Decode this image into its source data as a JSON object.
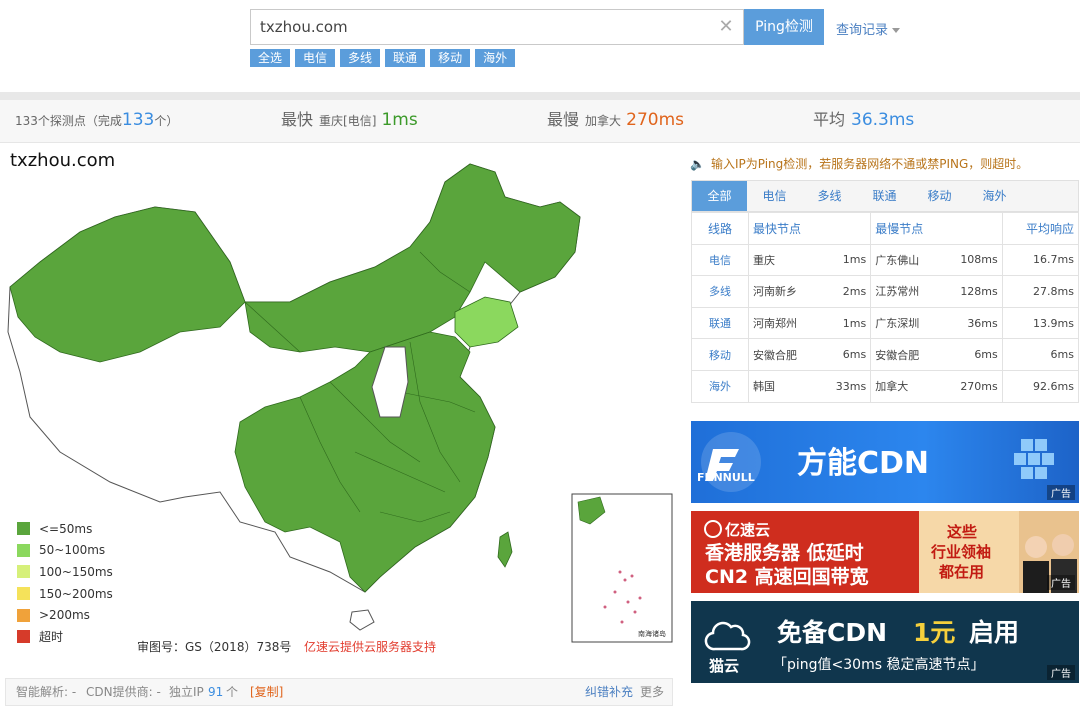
{
  "search": {
    "value": "txzhou.com",
    "button": "Ping检测",
    "history": "查询记录"
  },
  "filters": [
    "全选",
    "电信",
    "多线",
    "联通",
    "移动",
    "海外"
  ],
  "stats": {
    "count_prefix": "133个探测点（完成",
    "count": "133",
    "count_suffix": "个）",
    "fastest_label": "最快",
    "fastest_node": "重庆[电信]",
    "fastest_value": "1ms",
    "slowest_label": "最慢",
    "slowest_node": "加拿大",
    "slowest_value": "270ms",
    "avg_label": "平均",
    "avg_value": "36.3ms"
  },
  "site_title": "txzhou.com",
  "legend": [
    {
      "label": "<=50ms",
      "color": "#5aa53c"
    },
    {
      "label": "50~100ms",
      "color": "#8bd85e"
    },
    {
      "label": "100~150ms",
      "color": "#d6f07a"
    },
    {
      "label": "150~200ms",
      "color": "#f5e25a"
    },
    {
      "label": ">200ms",
      "color": "#f0a23a"
    },
    {
      "label": "超时",
      "color": "#d63b2a"
    }
  ],
  "map": {
    "note": "审图号：GS（2018）738号",
    "sponsor": "亿速云提供云服务器支持",
    "inset_label": "南海诸岛"
  },
  "bottom": {
    "dns": "智能解析: -",
    "cdn": "CDN提供商: -",
    "ip_label": "独立IP",
    "ip_count": "91",
    "ip_unit": "个",
    "copy": "[复制]",
    "fix": "纠错补充",
    "more": "更多"
  },
  "tip": "输入IP为Ping检测，若服务器网络不通或禁PING，则超时。",
  "tabs": [
    "全部",
    "电信",
    "多线",
    "联通",
    "移动",
    "海外"
  ],
  "table": {
    "headers": {
      "line": "线路",
      "fastest": "最快节点",
      "slowest": "最慢节点",
      "avg": "平均响应"
    },
    "rows": [
      {
        "line": "电信",
        "fast_node": "重庆",
        "fast_ms": "1ms",
        "slow_node": "广东佛山",
        "slow_ms": "108ms",
        "avg": "16.7ms"
      },
      {
        "line": "多线",
        "fast_node": "河南新乡",
        "fast_ms": "2ms",
        "slow_node": "江苏常州",
        "slow_ms": "128ms",
        "avg": "27.8ms"
      },
      {
        "line": "联通",
        "fast_node": "河南郑州",
        "fast_ms": "1ms",
        "slow_node": "广东深圳",
        "slow_ms": "36ms",
        "avg": "13.9ms"
      },
      {
        "line": "移动",
        "fast_node": "安徽合肥",
        "fast_ms": "6ms",
        "slow_node": "安徽合肥",
        "slow_ms": "6ms",
        "avg": "6ms"
      },
      {
        "line": "海外",
        "fast_node": "韩国",
        "fast_ms": "33ms",
        "slow_node": "加拿大",
        "slow_ms": "270ms",
        "avg": "92.6ms"
      }
    ]
  },
  "ads": {
    "tag": "广告",
    "ad1": {
      "brand": "FUNNULL",
      "title": "方能CDN"
    },
    "ad2": {
      "brand": "亿速云",
      "line1": "香港服务器 低延时",
      "line2": "CN2 高速回国带宽",
      "side1": "这些",
      "side2": "行业领袖",
      "side3": "都在用"
    },
    "ad3": {
      "brand": "猫云",
      "title_a": "免备CDN",
      "title_b": "1元",
      "title_c": "启用",
      "subtitle": "「ping值<30ms 稳定高速节点」"
    }
  }
}
